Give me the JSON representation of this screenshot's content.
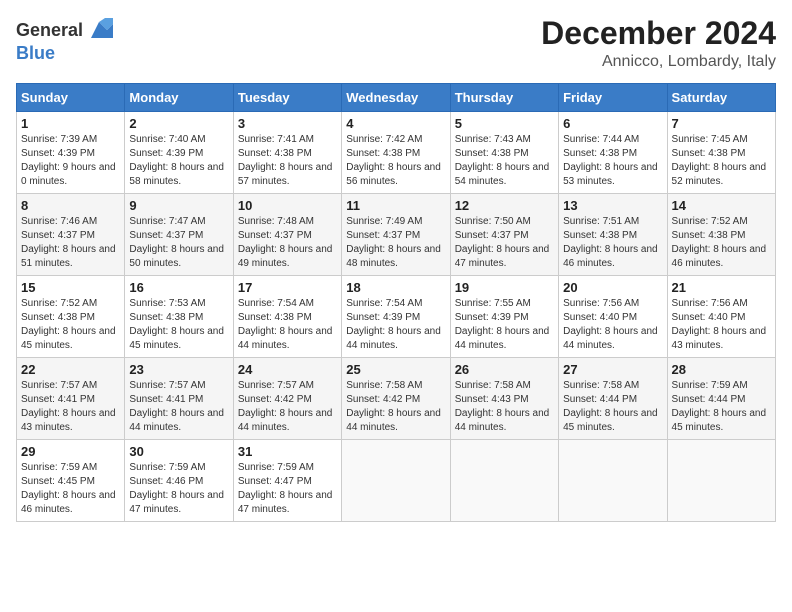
{
  "header": {
    "logo_general": "General",
    "logo_blue": "Blue",
    "month": "December 2024",
    "location": "Annicco, Lombardy, Italy"
  },
  "days_of_week": [
    "Sunday",
    "Monday",
    "Tuesday",
    "Wednesday",
    "Thursday",
    "Friday",
    "Saturday"
  ],
  "weeks": [
    [
      {
        "day": "1",
        "sunrise": "Sunrise: 7:39 AM",
        "sunset": "Sunset: 4:39 PM",
        "daylight": "Daylight: 9 hours and 0 minutes."
      },
      {
        "day": "2",
        "sunrise": "Sunrise: 7:40 AM",
        "sunset": "Sunset: 4:39 PM",
        "daylight": "Daylight: 8 hours and 58 minutes."
      },
      {
        "day": "3",
        "sunrise": "Sunrise: 7:41 AM",
        "sunset": "Sunset: 4:38 PM",
        "daylight": "Daylight: 8 hours and 57 minutes."
      },
      {
        "day": "4",
        "sunrise": "Sunrise: 7:42 AM",
        "sunset": "Sunset: 4:38 PM",
        "daylight": "Daylight: 8 hours and 56 minutes."
      },
      {
        "day": "5",
        "sunrise": "Sunrise: 7:43 AM",
        "sunset": "Sunset: 4:38 PM",
        "daylight": "Daylight: 8 hours and 54 minutes."
      },
      {
        "day": "6",
        "sunrise": "Sunrise: 7:44 AM",
        "sunset": "Sunset: 4:38 PM",
        "daylight": "Daylight: 8 hours and 53 minutes."
      },
      {
        "day": "7",
        "sunrise": "Sunrise: 7:45 AM",
        "sunset": "Sunset: 4:38 PM",
        "daylight": "Daylight: 8 hours and 52 minutes."
      }
    ],
    [
      {
        "day": "8",
        "sunrise": "Sunrise: 7:46 AM",
        "sunset": "Sunset: 4:37 PM",
        "daylight": "Daylight: 8 hours and 51 minutes."
      },
      {
        "day": "9",
        "sunrise": "Sunrise: 7:47 AM",
        "sunset": "Sunset: 4:37 PM",
        "daylight": "Daylight: 8 hours and 50 minutes."
      },
      {
        "day": "10",
        "sunrise": "Sunrise: 7:48 AM",
        "sunset": "Sunset: 4:37 PM",
        "daylight": "Daylight: 8 hours and 49 minutes."
      },
      {
        "day": "11",
        "sunrise": "Sunrise: 7:49 AM",
        "sunset": "Sunset: 4:37 PM",
        "daylight": "Daylight: 8 hours and 48 minutes."
      },
      {
        "day": "12",
        "sunrise": "Sunrise: 7:50 AM",
        "sunset": "Sunset: 4:37 PM",
        "daylight": "Daylight: 8 hours and 47 minutes."
      },
      {
        "day": "13",
        "sunrise": "Sunrise: 7:51 AM",
        "sunset": "Sunset: 4:38 PM",
        "daylight": "Daylight: 8 hours and 46 minutes."
      },
      {
        "day": "14",
        "sunrise": "Sunrise: 7:52 AM",
        "sunset": "Sunset: 4:38 PM",
        "daylight": "Daylight: 8 hours and 46 minutes."
      }
    ],
    [
      {
        "day": "15",
        "sunrise": "Sunrise: 7:52 AM",
        "sunset": "Sunset: 4:38 PM",
        "daylight": "Daylight: 8 hours and 45 minutes."
      },
      {
        "day": "16",
        "sunrise": "Sunrise: 7:53 AM",
        "sunset": "Sunset: 4:38 PM",
        "daylight": "Daylight: 8 hours and 45 minutes."
      },
      {
        "day": "17",
        "sunrise": "Sunrise: 7:54 AM",
        "sunset": "Sunset: 4:38 PM",
        "daylight": "Daylight: 8 hours and 44 minutes."
      },
      {
        "day": "18",
        "sunrise": "Sunrise: 7:54 AM",
        "sunset": "Sunset: 4:39 PM",
        "daylight": "Daylight: 8 hours and 44 minutes."
      },
      {
        "day": "19",
        "sunrise": "Sunrise: 7:55 AM",
        "sunset": "Sunset: 4:39 PM",
        "daylight": "Daylight: 8 hours and 44 minutes."
      },
      {
        "day": "20",
        "sunrise": "Sunrise: 7:56 AM",
        "sunset": "Sunset: 4:40 PM",
        "daylight": "Daylight: 8 hours and 44 minutes."
      },
      {
        "day": "21",
        "sunrise": "Sunrise: 7:56 AM",
        "sunset": "Sunset: 4:40 PM",
        "daylight": "Daylight: 8 hours and 43 minutes."
      }
    ],
    [
      {
        "day": "22",
        "sunrise": "Sunrise: 7:57 AM",
        "sunset": "Sunset: 4:41 PM",
        "daylight": "Daylight: 8 hours and 43 minutes."
      },
      {
        "day": "23",
        "sunrise": "Sunrise: 7:57 AM",
        "sunset": "Sunset: 4:41 PM",
        "daylight": "Daylight: 8 hours and 44 minutes."
      },
      {
        "day": "24",
        "sunrise": "Sunrise: 7:57 AM",
        "sunset": "Sunset: 4:42 PM",
        "daylight": "Daylight: 8 hours and 44 minutes."
      },
      {
        "day": "25",
        "sunrise": "Sunrise: 7:58 AM",
        "sunset": "Sunset: 4:42 PM",
        "daylight": "Daylight: 8 hours and 44 minutes."
      },
      {
        "day": "26",
        "sunrise": "Sunrise: 7:58 AM",
        "sunset": "Sunset: 4:43 PM",
        "daylight": "Daylight: 8 hours and 44 minutes."
      },
      {
        "day": "27",
        "sunrise": "Sunrise: 7:58 AM",
        "sunset": "Sunset: 4:44 PM",
        "daylight": "Daylight: 8 hours and 45 minutes."
      },
      {
        "day": "28",
        "sunrise": "Sunrise: 7:59 AM",
        "sunset": "Sunset: 4:44 PM",
        "daylight": "Daylight: 8 hours and 45 minutes."
      }
    ],
    [
      {
        "day": "29",
        "sunrise": "Sunrise: 7:59 AM",
        "sunset": "Sunset: 4:45 PM",
        "daylight": "Daylight: 8 hours and 46 minutes."
      },
      {
        "day": "30",
        "sunrise": "Sunrise: 7:59 AM",
        "sunset": "Sunset: 4:46 PM",
        "daylight": "Daylight: 8 hours and 47 minutes."
      },
      {
        "day": "31",
        "sunrise": "Sunrise: 7:59 AM",
        "sunset": "Sunset: 4:47 PM",
        "daylight": "Daylight: 8 hours and 47 minutes."
      },
      null,
      null,
      null,
      null
    ]
  ]
}
